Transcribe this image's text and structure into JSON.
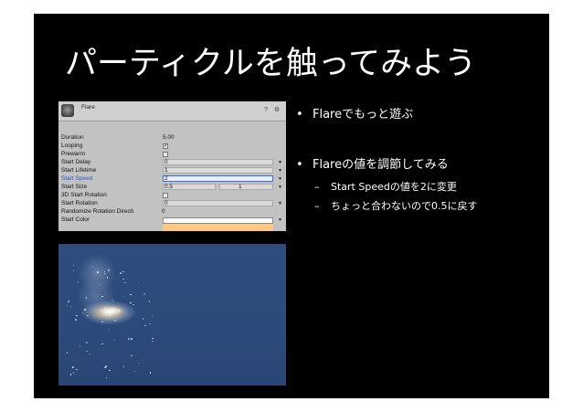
{
  "slide": {
    "title": "パーティクルを触ってみよう"
  },
  "inspector": {
    "component_title": "Flare",
    "tools": [
      "?",
      "⚙"
    ],
    "properties": [
      {
        "label": "Duration",
        "value": "5.00",
        "kind": "text"
      },
      {
        "label": "Looping",
        "value": "✓",
        "kind": "check"
      },
      {
        "label": "Prewarm",
        "value": "",
        "kind": "check"
      },
      {
        "label": "Start Delay",
        "value": "0",
        "kind": "dropdown"
      },
      {
        "label": "Start Lifetime",
        "value": "1",
        "kind": "dropdown"
      },
      {
        "label": "Start Speed",
        "value": "2",
        "kind": "dropdown-active"
      },
      {
        "label": "Start Size",
        "value": "0.5",
        "value2": "1",
        "kind": "range"
      },
      {
        "label": "3D Start Rotation",
        "value": "",
        "kind": "check"
      },
      {
        "label": "Start Rotation",
        "value": "0",
        "kind": "dropdown"
      },
      {
        "label": "Randomize Rotation Directi",
        "value": "0",
        "kind": "text"
      },
      {
        "label": "Start Color",
        "value": "",
        "kind": "color"
      }
    ],
    "colors": {
      "active_label": "#2a57c9",
      "start_color_top": "#ffffff",
      "start_color_bottom": "#ffc784"
    }
  },
  "preview": {
    "background": "#2f4d7c"
  },
  "bullets": [
    {
      "level": 1,
      "marker": "•",
      "text": "Flareでもっと遊ぶ"
    },
    {
      "level": 1,
      "marker": "•",
      "text": "Flareの値を調節してみる"
    },
    {
      "level": 2,
      "marker": "–",
      "text": "Start Speedの値を2に変更"
    },
    {
      "level": 2,
      "marker": "–",
      "text": "ちょっと合わないので0.5に戻す"
    }
  ]
}
